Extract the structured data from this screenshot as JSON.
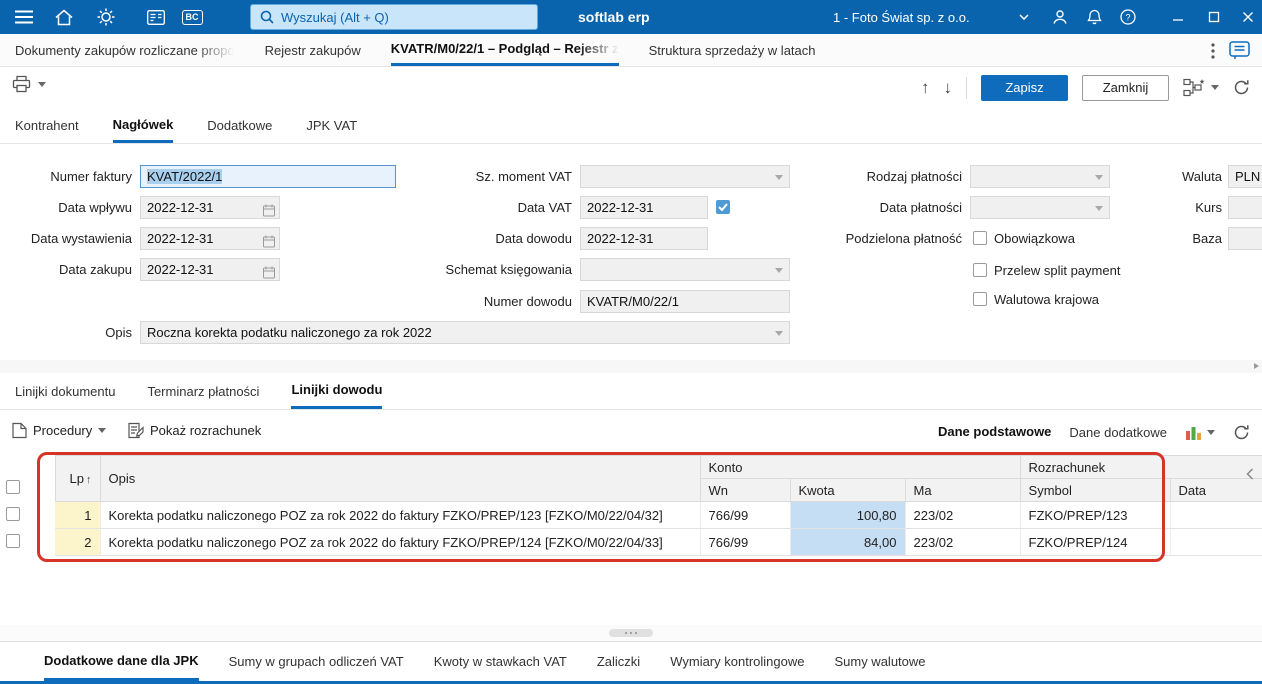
{
  "topbar": {
    "search_placeholder": "Wyszukaj (Alt + Q)",
    "app_title": "softlab erp",
    "company": "1 - Foto Świat sp. z o.o.",
    "bc_badge": "BC"
  },
  "document_tabs": {
    "tab1": "Dokumenty zakupów rozliczane propo",
    "tab2": "Rejestr zakupów",
    "tab3": "KVATR/M0/22/1 – Podgląd – Rejestr z",
    "tab4": "Struktura sprzedaży w latach"
  },
  "toolbar": {
    "save_label": "Zapisz",
    "close_label": "Zamknij"
  },
  "header_tabs": {
    "kontrahent": "Kontrahent",
    "naglowek": "Nagłówek",
    "dodatkowe": "Dodatkowe",
    "jpk_vat": "JPK VAT"
  },
  "form": {
    "numer_faktury_label": "Numer faktury",
    "numer_faktury_value": "KVAT/2022/1",
    "data_wplywu_label": "Data wpływu",
    "data_wplywu_value": "2022-12-31",
    "data_wystawienia_label": "Data wystawienia",
    "data_wystawienia_value": "2022-12-31",
    "data_zakupu_label": "Data zakupu",
    "data_zakupu_value": "2022-12-31",
    "sz_moment_vat_label": "Sz. moment VAT",
    "data_vat_label": "Data VAT",
    "data_vat_value": "2022-12-31",
    "data_dowodu_label": "Data dowodu",
    "data_dowodu_value": "2022-12-31",
    "schemat_ksiegowania_label": "Schemat księgowania",
    "numer_dowodu_label": "Numer dowodu",
    "numer_dowodu_value": "KVATR/M0/22/1",
    "opis_label": "Opis",
    "opis_value": "Roczna korekta podatku naliczonego za rok 2022",
    "rodzaj_platnosci_label": "Rodzaj płatności",
    "data_platnosci_label": "Data płatności",
    "podzielona_platnosc_label": "Podzielona płatność",
    "obowiazkowa_label": "Obowiązkowa",
    "przelew_split_label": "Przelew split payment",
    "walutowa_krajowa_label": "Walutowa krajowa",
    "waluta_label": "Waluta",
    "waluta_value": "PLN",
    "kurs_label": "Kurs",
    "baza_label": "Baza"
  },
  "lines_tabs": {
    "linijki_dokumentu": "Linijki dokumentu",
    "terminarz_platnosci": "Terminarz płatności",
    "linijki_dowodu": "Linijki dowodu"
  },
  "lines_toolbar": {
    "procedury": "Procedury",
    "pokaz_rozrachunek": "Pokaż rozrachunek",
    "dane_podstawowe": "Dane podstawowe",
    "dane_dodatkowe": "Dane dodatkowe"
  },
  "table": {
    "headers": {
      "lp": "Lp",
      "opis": "Opis",
      "konto": "Konto",
      "rozrachunek": "Rozrachunek",
      "wn": "Wn",
      "kwota": "Kwota",
      "ma": "Ma",
      "symbol": "Symbol",
      "data": "Data"
    },
    "sort_icon": "↑",
    "rows": [
      {
        "lp": "1",
        "opis": "Korekta podatku naliczonego POZ za rok 2022 do faktury FZKO/PREP/123 [FZKO/M0/22/04/32]",
        "wn": "766/99",
        "kwota": "100,80",
        "ma": "223/02",
        "symbol": "FZKO/PREP/123",
        "data": ""
      },
      {
        "lp": "2",
        "opis": "Korekta podatku naliczonego POZ za rok 2022 do faktury FZKO/PREP/124 [FZKO/M0/22/04/33]",
        "wn": "766/99",
        "kwota": "84,00",
        "ma": "223/02",
        "symbol": "FZKO/PREP/124",
        "data": ""
      }
    ]
  },
  "bottom_tabs": {
    "t1": "Dodatkowe dane dla JPK",
    "t2": "Sumy w grupach odliczeń VAT",
    "t3": "Kwoty w stawkach VAT",
    "t4": "Zaliczki",
    "t5": "Wymiary kontrolingowe",
    "t6": "Sumy walutowe"
  },
  "colors": {
    "topbar_blue": "#0a64ad",
    "accent_blue": "#0f6cbd",
    "annotation_red": "#d63426",
    "lp_yellow": "#fcf4cb",
    "kwota_blue": "#c6def4"
  }
}
